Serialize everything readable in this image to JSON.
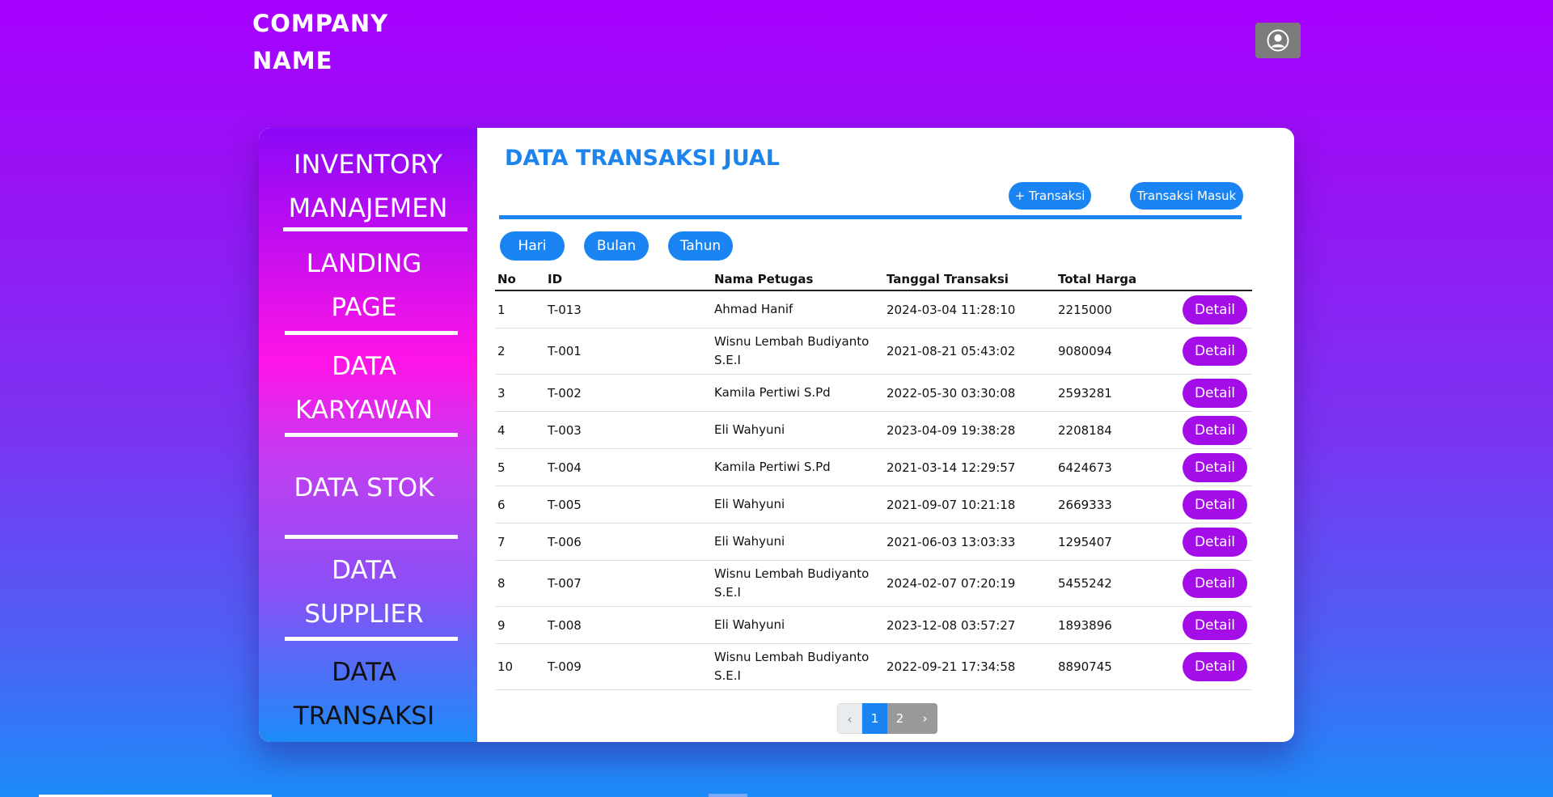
{
  "header": {
    "company_line1": "COMPANY",
    "company_line2": "NAME",
    "profile_icon": "user-circle-icon"
  },
  "sidebar": {
    "brand_line1": "INVENTORY",
    "brand_line2": "MANAJEMEN",
    "items": [
      {
        "line1": "LANDING",
        "line2": "PAGE"
      },
      {
        "line1": "DATA",
        "line2": "KARYAWAN"
      },
      {
        "line1": "DATA STOK"
      },
      {
        "line1": "DATA",
        "line2": "SUPPLIER"
      },
      {
        "line1": "DATA",
        "line2": "TRANSAKSI"
      }
    ]
  },
  "main": {
    "title": "DATA TRANSAKSI JUAL",
    "add_button": "+ Transaksi",
    "incoming_button": "Transaksi Masuk",
    "filters": [
      "Hari",
      "Bulan",
      "Tahun"
    ],
    "table": {
      "columns": [
        "No",
        "ID",
        "Nama Petugas",
        "Tanggal Transaksi",
        "Total Harga"
      ],
      "action_label": "Detail",
      "rows": [
        {
          "no": "1",
          "id": "T-013",
          "name_line1": "Ahmad Hanif",
          "name_line2": "",
          "date": "2024-03-04 11:28:10",
          "total": "2215000"
        },
        {
          "no": "2",
          "id": "T-001",
          "name_line1": "Wisnu Lembah Budiyanto",
          "name_line2": "S.E.I",
          "date": "2021-08-21 05:43:02",
          "total": "9080094"
        },
        {
          "no": "3",
          "id": "T-002",
          "name_line1": "Kamila Pertiwi S.Pd",
          "name_line2": "",
          "date": "2022-05-30 03:30:08",
          "total": "2593281"
        },
        {
          "no": "4",
          "id": "T-003",
          "name_line1": "Eli Wahyuni",
          "name_line2": "",
          "date": "2023-04-09 19:38:28",
          "total": "2208184"
        },
        {
          "no": "5",
          "id": "T-004",
          "name_line1": "Kamila Pertiwi S.Pd",
          "name_line2": "",
          "date": "2021-03-14 12:29:57",
          "total": "6424673"
        },
        {
          "no": "6",
          "id": "T-005",
          "name_line1": "Eli Wahyuni",
          "name_line2": "",
          "date": "2021-09-07 10:21:18",
          "total": "2669333"
        },
        {
          "no": "7",
          "id": "T-006",
          "name_line1": "Eli Wahyuni",
          "name_line2": "",
          "date": "2021-06-03 13:03:33",
          "total": "1295407"
        },
        {
          "no": "8",
          "id": "T-007",
          "name_line1": "Wisnu Lembah Budiyanto",
          "name_line2": "S.E.I",
          "date": "2024-02-07 07:20:19",
          "total": "5455242"
        },
        {
          "no": "9",
          "id": "T-008",
          "name_line1": "Eli Wahyuni",
          "name_line2": "",
          "date": "2023-12-08 03:57:27",
          "total": "1893896"
        },
        {
          "no": "10",
          "id": "T-009",
          "name_line1": "Wisnu Lembah Budiyanto",
          "name_line2": "S.E.I",
          "date": "2022-09-21 17:34:58",
          "total": "8890745"
        }
      ]
    },
    "pagination": {
      "prev": "‹",
      "pages": [
        "1",
        "2"
      ],
      "next": "›",
      "current_page": "1"
    }
  },
  "colors": {
    "accent_blue": "#1a85f2",
    "detail_purple": "#a40de8",
    "bg_top": "#a600ff",
    "bg_bottom": "#1c8bf8"
  }
}
